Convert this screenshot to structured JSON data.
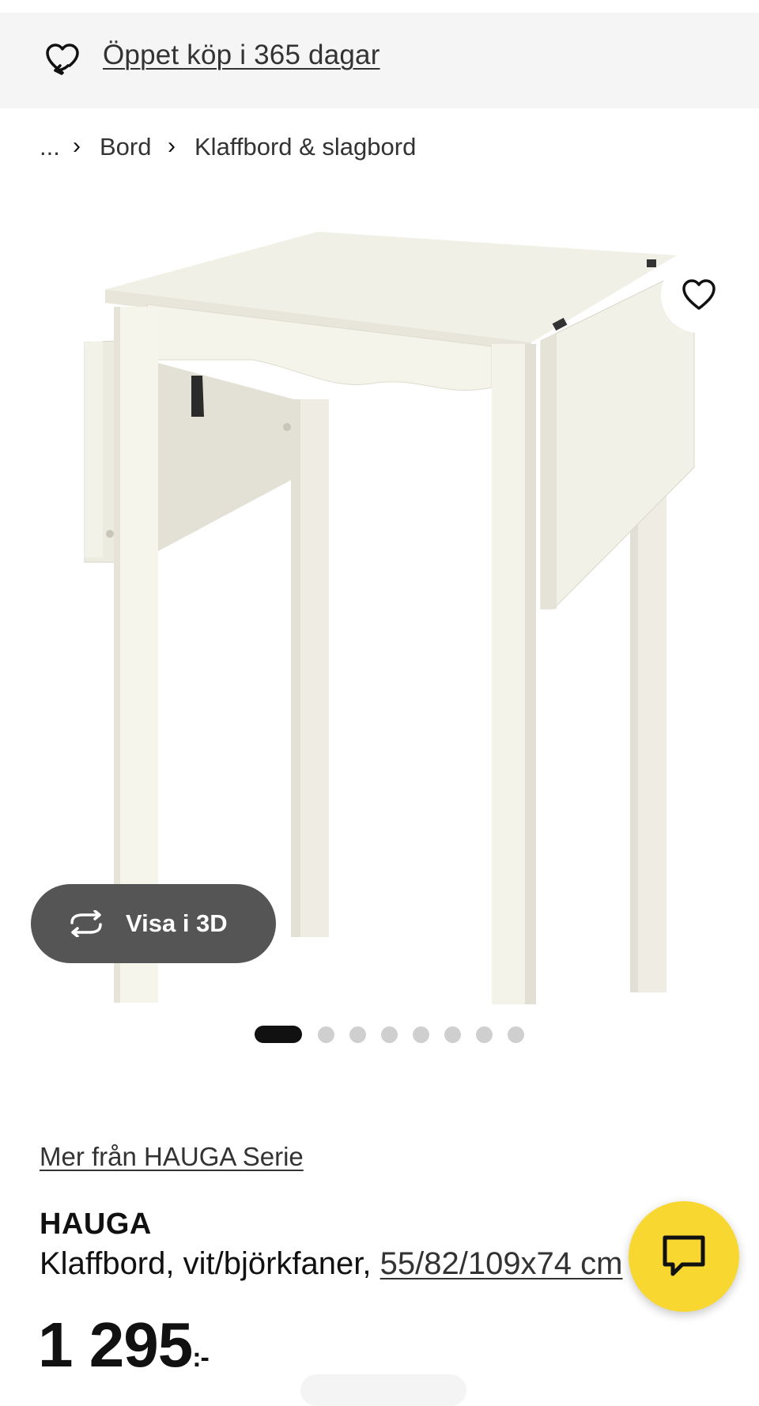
{
  "promo": {
    "text": "Öppet köp i 365 dagar",
    "icon": "heart-return-icon"
  },
  "breadcrumb": {
    "ellipsis": "...",
    "separator": "›",
    "items": [
      "Bord",
      "Klaffbord & slagbord"
    ]
  },
  "gallery": {
    "image_alt": "HAUGA Klaffbord",
    "view3d_label": "Visa i 3D",
    "view3d_icon": "rotate-3d-icon",
    "favorite_icon": "heart-outline-icon",
    "image_count": 8,
    "active_index": 0
  },
  "product": {
    "series_link": "Mer från HAUGA Serie",
    "name": "HAUGA",
    "description": "Klaffbord, vit/björkfaner, ",
    "size": "55/82/109x74 cm",
    "price": "1 295",
    "price_suffix": ":-"
  },
  "chat": {
    "icon": "chat-bubble-icon"
  },
  "colors": {
    "accent_yellow": "#f7d730",
    "promo_bg": "#f5f5f5",
    "button_dark": "#555555",
    "dot_active": "#111111",
    "dot_inactive": "#cfcfcf"
  }
}
